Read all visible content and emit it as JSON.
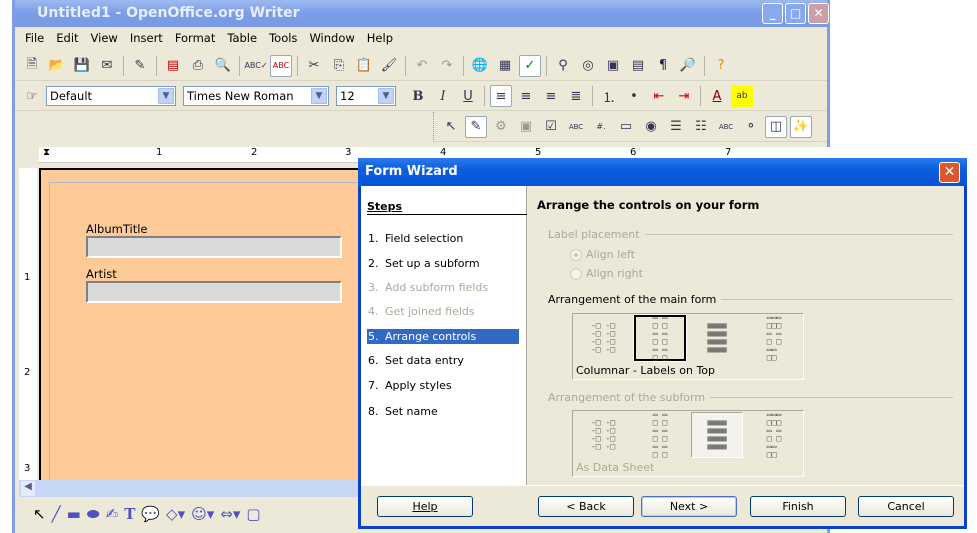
{
  "window": {
    "title": "Untitled1 - OpenOffice.org Writer",
    "controls": [
      "minimize",
      "maximize",
      "close"
    ]
  },
  "menu": [
    "File",
    "Edit",
    "View",
    "Insert",
    "Format",
    "Table",
    "Tools",
    "Window",
    "Help"
  ],
  "toolbar_standard": [
    "new-icon",
    "open-icon",
    "save-icon",
    "email-icon",
    "edit-file-icon",
    "pdf-icon",
    "print-icon",
    "page-preview-icon",
    "spellcheck-icon",
    "autospellcheck-icon",
    "cut-icon",
    "copy-icon",
    "paste-icon",
    "format-paintbrush-icon",
    "undo-icon",
    "redo-icon",
    "hyperlink-icon",
    "table-icon",
    "draw-functions-icon",
    "find-replace-icon",
    "navigator-icon",
    "gallery-icon",
    "data-sources-icon",
    "nonprinting-chars-icon",
    "zoom-icon",
    "help-icon"
  ],
  "formatting": {
    "style": "Default",
    "font": "Times New Roman",
    "size": "12",
    "buttons": [
      "B",
      "I",
      "U"
    ]
  },
  "ruler": {
    "labels": [
      "1",
      "2",
      "3",
      "4",
      "5",
      "6",
      "7"
    ],
    "vlabels": [
      "1",
      "2",
      "3"
    ]
  },
  "document": {
    "page_color": "#fecb98",
    "fields": [
      {
        "label": "AlbumTitle",
        "value": ""
      },
      {
        "label": "Artist",
        "value": ""
      }
    ]
  },
  "dialog": {
    "title": "Form Wizard",
    "steps_heading": "Steps",
    "steps": [
      {
        "num": "1.",
        "label": "Field selection",
        "state": "enabled"
      },
      {
        "num": "2.",
        "label": "Set up a subform",
        "state": "enabled"
      },
      {
        "num": "3.",
        "label": "Add subform fields",
        "state": "disabled"
      },
      {
        "num": "4.",
        "label": "Get joined fields",
        "state": "disabled"
      },
      {
        "num": "5.",
        "label": "Arrange controls",
        "state": "selected"
      },
      {
        "num": "6.",
        "label": "Set data entry",
        "state": "enabled"
      },
      {
        "num": "7.",
        "label": "Apply styles",
        "state": "enabled"
      },
      {
        "num": "8.",
        "label": "Set name",
        "state": "enabled"
      }
    ],
    "heading": "Arrange the controls on your form",
    "label_placement": {
      "title": "Label placement",
      "options": [
        "Align left",
        "Align right"
      ],
      "selected": "Align left",
      "disabled": true
    },
    "main_form": {
      "title": "Arrangement of the main form",
      "selected_label": "Columnar - Labels on Top",
      "selected_index": 1
    },
    "subform": {
      "title": "Arrangement of the subform",
      "selected_label": "As Data Sheet",
      "selected_index": 2,
      "disabled": true
    },
    "buttons": {
      "help": "Help",
      "back": "< Back",
      "next": "Next >",
      "finish": "Finish",
      "cancel": "Cancel"
    },
    "accent": "#316ac5"
  }
}
